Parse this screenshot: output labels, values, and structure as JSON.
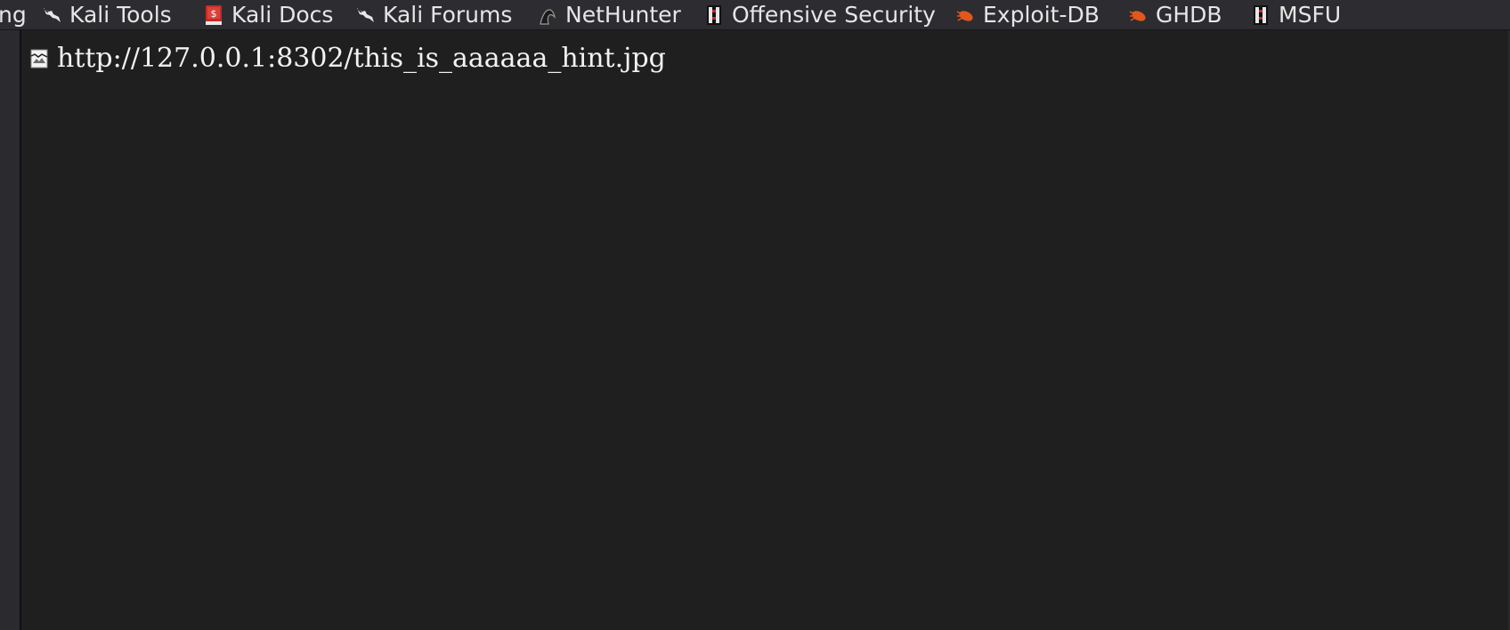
{
  "bookmarks": [
    {
      "label": "ng",
      "icon": "none"
    },
    {
      "label": "Kali Tools",
      "icon": "kali-dragon-icon"
    },
    {
      "label": "Kali Docs",
      "icon": "kali-docs-icon"
    },
    {
      "label": "Kali Forums",
      "icon": "kali-dragon-icon"
    },
    {
      "label": "NetHunter",
      "icon": "nethunter-icon"
    },
    {
      "label": "Offensive Security",
      "icon": "offsec-icon"
    },
    {
      "label": "Exploit-DB",
      "icon": "exploit-db-icon"
    },
    {
      "label": "GHDB",
      "icon": "exploit-db-icon"
    },
    {
      "label": "MSFU",
      "icon": "offsec-icon"
    }
  ],
  "content": {
    "broken_image_alt": "http://127.0.0.1:8302/this_is_aaaaaa_hint.jpg",
    "broken_image_icon": "broken-image-icon"
  },
  "colors": {
    "toolbar_bg": "#2d2c30",
    "content_bg": "#1f1f1f",
    "exploit_db_orange": "#e2581c",
    "docs_red": "#c72a25"
  }
}
